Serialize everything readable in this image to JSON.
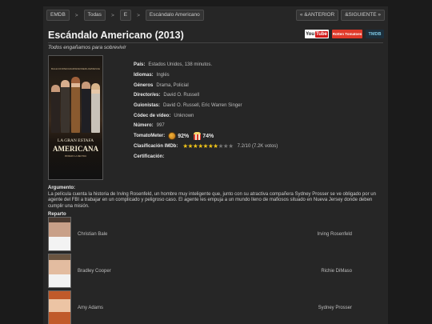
{
  "nav": {
    "crumbs": [
      "EMDB",
      "Todas",
      "E",
      "Escándalo Americano"
    ],
    "separator": ">",
    "prev": "« &ANTERIOR",
    "next": "&SIGUIENTE »"
  },
  "movie": {
    "title": "Escándalo Americano (2013)",
    "tagline": "Todos engañamos para sobrevivir"
  },
  "badges": {
    "youtube": "You",
    "youtube_tube": "Tube",
    "rotten": "Rotten Tomatoes",
    "tmdb": "TMDB"
  },
  "poster": {
    "cast_names": [
      "BALE",
      "COOPER",
      "ADAMS",
      "RENNER",
      "LAWRENCE"
    ],
    "line1": "LA GRAN ESTAFA",
    "line2": "AMERICANA",
    "line3": "PRIMERO LA MENTIRA"
  },
  "info": {
    "pais": {
      "label": "País:",
      "value": "Estados Unidos, 138 minutos."
    },
    "idiomas": {
      "label": "Idiomas:",
      "value": "Inglés"
    },
    "generos": {
      "label": "Géneros",
      "value": "Drama, Policial"
    },
    "director": {
      "label": "Director/es:",
      "value": "David O. Russell"
    },
    "guionistas": {
      "label": "Guionistas:",
      "value": "David O. Russell, Eric Warren Singer"
    },
    "codec": {
      "label": "Códec de vídeo:",
      "value": "Unknown"
    },
    "numero": {
      "label": "Número:",
      "value": "997"
    },
    "tomatometer": {
      "label": "TomatoMeter:",
      "critics": "92%",
      "audience": "74%"
    },
    "imdb": {
      "label": "Clasificación IMDb:",
      "rating": 7.2,
      "stars_on": "★★★★★★★",
      "stars_off": "★★★",
      "value": "7.2/10 (7.2K votos)"
    },
    "certificacion": {
      "label": "Certificación:"
    }
  },
  "argument": {
    "label": "Argumento:",
    "text": "La película cuenta la historia de Irving Rosenfeld, un hombre muy inteligente que, junto con su atractiva compañera Sydney Prosser se ve obligado por un agente del FBI a trabajar en un complicado y peligroso caso. El agente les empuja a un mundo lleno de mafiosos situado en Nueva Jersey donde deben cumplir una misión."
  },
  "cast": {
    "label": "Reparto",
    "items": [
      {
        "actor": "Christian Bale",
        "role": "Irving Rosenfeld"
      },
      {
        "actor": "Bradley Cooper",
        "role": "Richie DiMaso"
      },
      {
        "actor": "Amy Adams",
        "role": "Sydney Prosser"
      }
    ]
  }
}
